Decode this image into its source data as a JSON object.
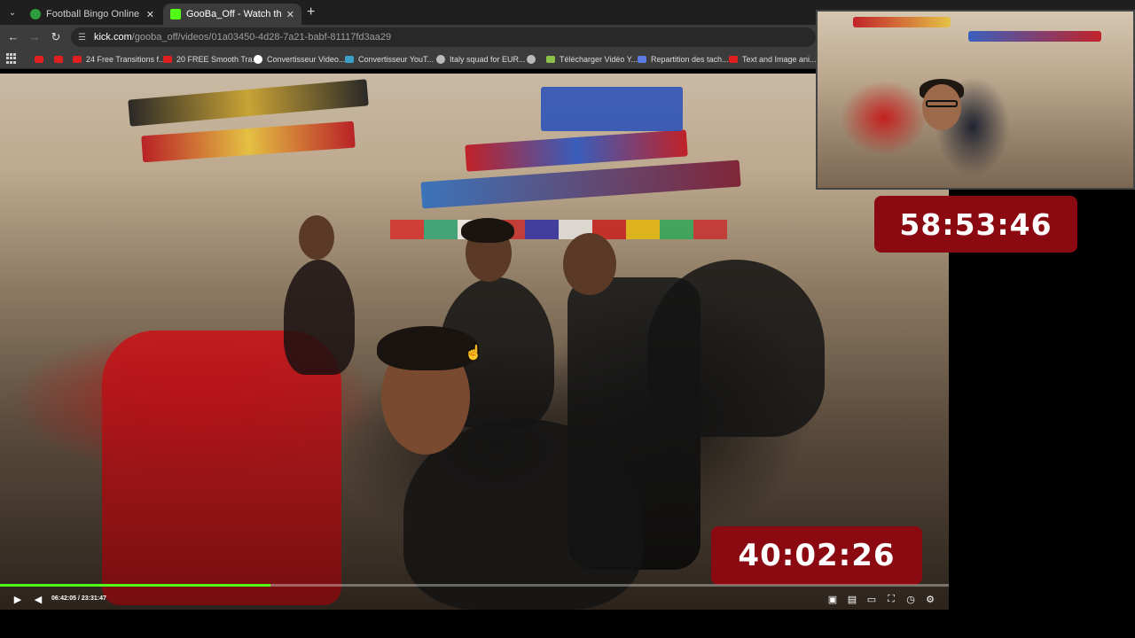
{
  "browser": {
    "tabs": [
      {
        "title": "Football Bingo Online - Play No",
        "favicon_color": "#2e9b3f"
      },
      {
        "title": "GooBa_Off - Watch the VOD on",
        "favicon_color": "#53fc18"
      }
    ],
    "new_tab_symbol": "+",
    "address": {
      "host": "kick.com",
      "path": "/gooba_off/videos/01a03450-4d28-7a21-babf-81117fd3aa29"
    },
    "bookmarks": [
      {
        "label": "",
        "icon": "youtube-icon",
        "color": "#e02020"
      },
      {
        "label": "",
        "icon": "youtube-icon",
        "color": "#e02020"
      },
      {
        "label": "24 Free Transitions f...",
        "icon": "youtube-icon",
        "color": "#e02020"
      },
      {
        "label": "20 FREE Smooth Tra...",
        "icon": "youtube-icon",
        "color": "#e02020"
      },
      {
        "label": "Convertisseur Video...",
        "icon": "google-icon",
        "color": "#ffffff"
      },
      {
        "label": "Convertisseur YouT...",
        "icon": "converter-icon",
        "color": "#3aa0c8"
      },
      {
        "label": "Italy squad for EUR...",
        "icon": "globe-icon",
        "color": "#bbbbbb"
      },
      {
        "label": "",
        "icon": "globe-icon",
        "color": "#bbbbbb"
      },
      {
        "label": "Télécharger Vidéo Y...",
        "icon": "download-icon",
        "color": "#8bc34a"
      },
      {
        "label": "Repartition des tach...",
        "icon": "forms-icon",
        "color": "#5b7be0"
      },
      {
        "label": "Text and Image ani...",
        "icon": "youtube-icon",
        "color": "#e02020"
      }
    ]
  },
  "video": {
    "timer_main": "40:02:26",
    "timer_overlay": "58:53:46",
    "time_current": "06:42:05",
    "time_total": "23:31:47",
    "time_separator": " / ",
    "progress_percent": 28.5,
    "accent": "#53fc18"
  }
}
